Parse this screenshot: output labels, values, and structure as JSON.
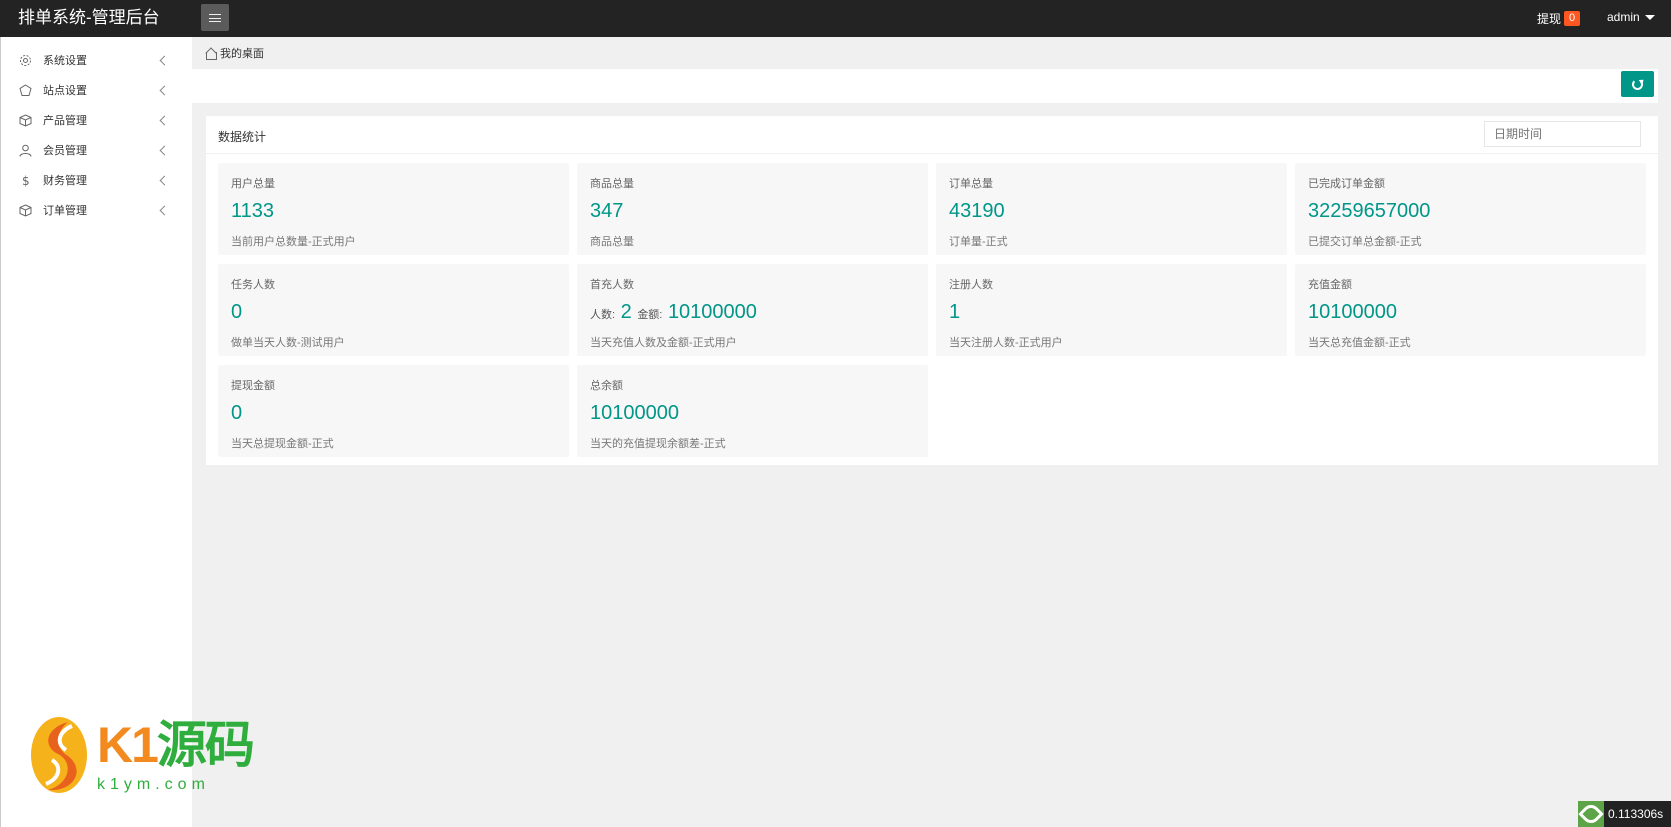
{
  "header": {
    "title": "排单系统-管理后台",
    "withdraw_label": "提现",
    "withdraw_badge": "0",
    "user": "admin"
  },
  "sidebar": {
    "items": [
      {
        "label": "系统设置",
        "icon": "gear-icon"
      },
      {
        "label": "站点设置",
        "icon": "site-icon"
      },
      {
        "label": "产品管理",
        "icon": "cube-icon"
      },
      {
        "label": "会员管理",
        "icon": "user-icon"
      },
      {
        "label": "财务管理",
        "icon": "dollar-icon"
      },
      {
        "label": "订单管理",
        "icon": "box-icon"
      }
    ]
  },
  "breadcrumb": {
    "home": "我的桌面"
  },
  "panel": {
    "title": "数据统计",
    "date_placeholder": "日期时间"
  },
  "cards": [
    {
      "title": "用户总量",
      "value": "1133",
      "sub": "当前用户总数量-正式用户"
    },
    {
      "title": "商品总量",
      "value": "347",
      "sub": "商品总量"
    },
    {
      "title": "订单总量",
      "value": "43190",
      "sub": "订单量-正式"
    },
    {
      "title": "已完成订单金额",
      "value": "32259657000",
      "sub": "已提交订单总金额-正式"
    },
    {
      "title": "任务人数",
      "value": "0",
      "sub": "做单当天人数-测试用户"
    },
    {
      "title": "首充人数",
      "count_label": "人数:",
      "count": "2",
      "amount_label": "金额:",
      "amount": "10100000",
      "sub": "当天充值人数及金额-正式用户"
    },
    {
      "title": "注册人数",
      "value": "1",
      "sub": "当天注册人数-正式用户"
    },
    {
      "title": "充值金额",
      "value": "10100000",
      "sub": "当天总充值金额-正式"
    },
    {
      "title": "提现金额",
      "value": "0",
      "sub": "当天总提现金额-正式"
    },
    {
      "title": "总余额",
      "value": "10100000",
      "sub": "当天的充值提现余额差-正式"
    }
  ],
  "watermark": {
    "brand_k1": "K1",
    "brand_cn": "源码",
    "url": "k1ym.com"
  },
  "timer": {
    "text": "0.113306s"
  },
  "colors": {
    "accent": "#009688",
    "header": "#232323",
    "badge": "#ff5722"
  }
}
